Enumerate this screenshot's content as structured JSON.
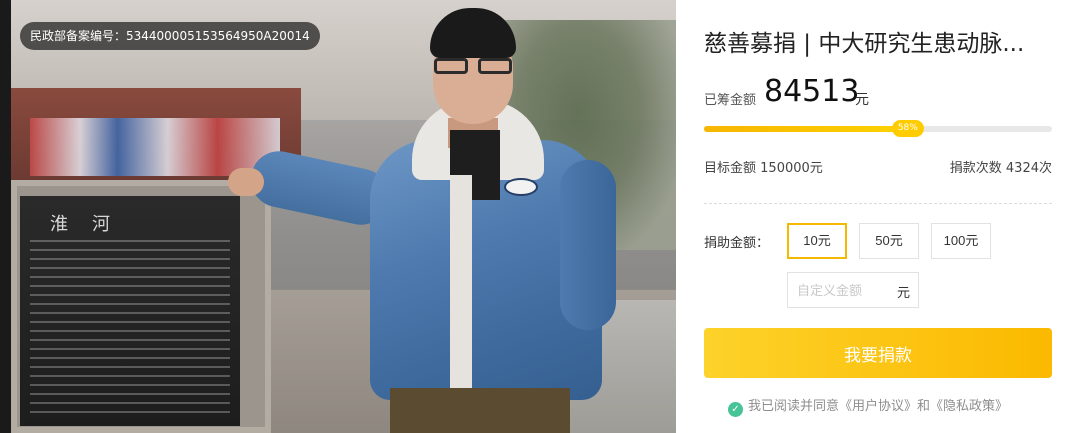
{
  "badge": {
    "text": "民政部备案编号：534400005153564950A20014"
  },
  "project": {
    "title": "慈善募捐 | 中大研究生患动脉..."
  },
  "raised": {
    "label": "已筹金额",
    "amount": "84513",
    "unit": "元"
  },
  "progress": {
    "percent": 58,
    "label": "58%"
  },
  "goal": {
    "label": "目标金额",
    "value": "150000元"
  },
  "donations": {
    "label": "捐款次数",
    "value": "4324次"
  },
  "donate": {
    "label": "捐助金额：",
    "options": [
      "10元",
      "50元",
      "100元"
    ],
    "selected_index": 0,
    "custom_placeholder": "自定义金额",
    "custom_unit": "元",
    "button_label": "我要捐款"
  },
  "agreement": {
    "prefix": "我已阅读并同意",
    "user_agreement": "《用户协议》",
    "and": "和",
    "privacy_policy": "《隐私政策》"
  },
  "colors": {
    "accent": "#fbb900",
    "check": "#46c497"
  }
}
